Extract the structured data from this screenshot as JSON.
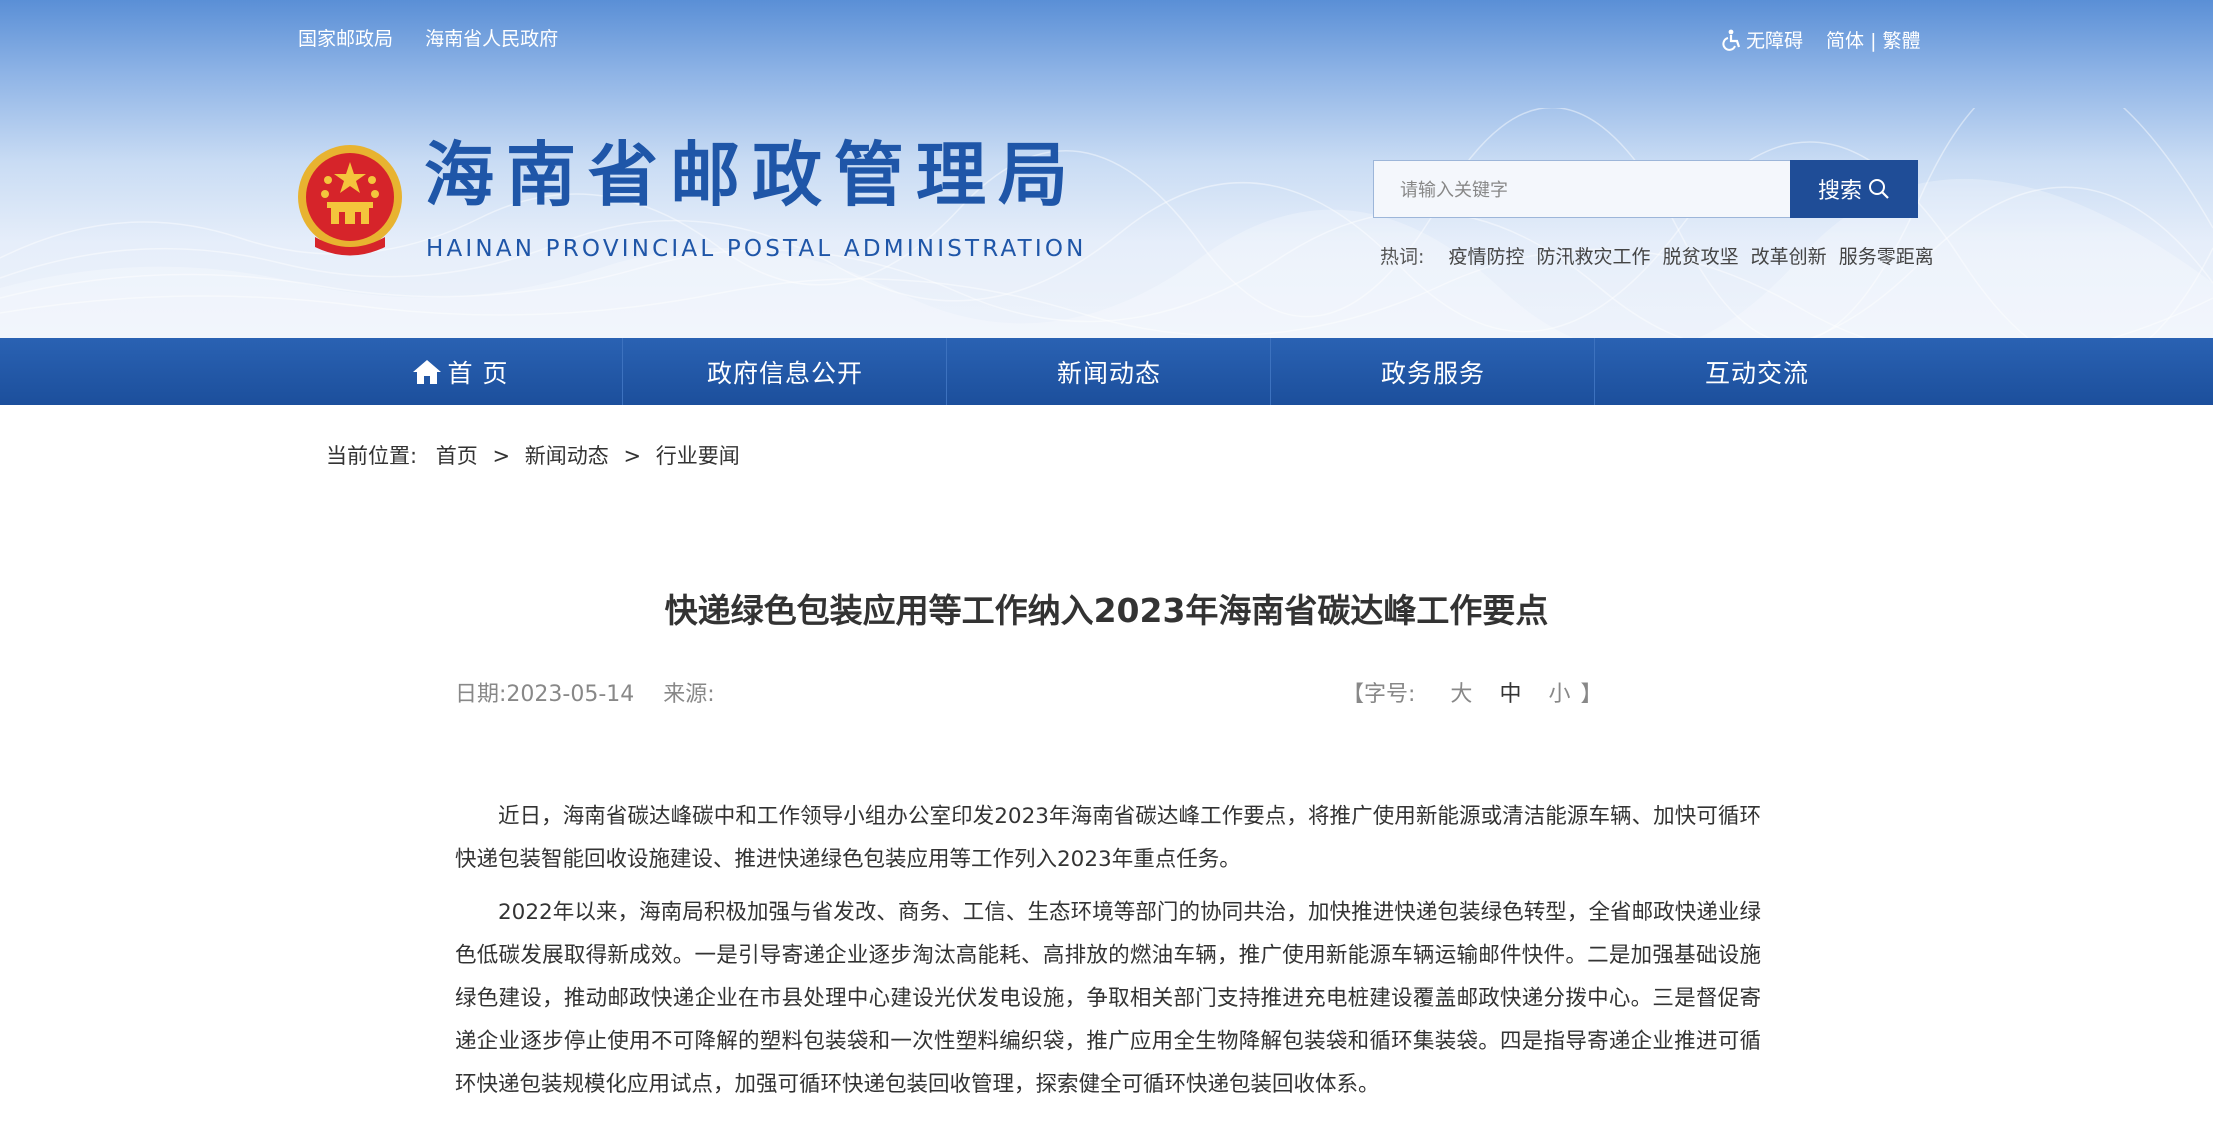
{
  "top_links": [
    "国家邮政局",
    "海南省人民政府"
  ],
  "accessibility_label": "无障碍",
  "lang": {
    "simplified": "简体",
    "divider": "|",
    "traditional": "繁體"
  },
  "site": {
    "title_cn": "海南省邮政管理局",
    "title_en": "HAINAN PROVINCIAL POSTAL ADMINISTRATION"
  },
  "search": {
    "placeholder": "请输入关键字",
    "button": "搜索"
  },
  "hot_words": {
    "label": "热词:",
    "items": [
      "疫情防控",
      "防汛救灾工作",
      "脱贫攻坚",
      "改革创新",
      "服务零距离"
    ]
  },
  "nav": [
    "首 页",
    "政府信息公开",
    "新闻动态",
    "政务服务",
    "互动交流"
  ],
  "breadcrumb": {
    "label": "当前位置:",
    "items": [
      "首页",
      "新闻动态",
      "行业要闻"
    ],
    "separator": ">"
  },
  "article": {
    "title": "快递绿色包装应用等工作纳入2023年海南省碳达峰工作要点",
    "date_label": "日期:",
    "date": "2023-05-14",
    "source_label": "来源:",
    "font_size": {
      "open": "【字号:",
      "large": "大",
      "medium": "中",
      "small": "小",
      "close": "】"
    },
    "paragraphs": [
      "近日，海南省碳达峰碳中和工作领导小组办公室印发2023年海南省碳达峰工作要点，将推广使用新能源或清洁能源车辆、加快可循环快递包装智能回收设施建设、推进快递绿色包装应用等工作列入2023年重点任务。",
      "2022年以来，海南局积极加强与省发改、商务、工信、生态环境等部门的协同共治，加快推进快递包装绿色转型，全省邮政快递业绿色低碳发展取得新成效。一是引导寄递企业逐步淘汰高能耗、高排放的燃油车辆，推广使用新能源车辆运输邮件快件。二是加强基础设施绿色建设，推动邮政快递企业在市县处理中心建设光伏发电设施，争取相关部门支持推进充电桩建设覆盖邮政快递分拨中心。三是督促寄递企业逐步停止使用不可降解的塑料包装袋和一次性塑料编织袋，推广应用全生物降解包装袋和循环集装袋。四是指导寄递企业推进可循环快递包装规模化应用试点，加强可循环快递包装回收管理，探索健全可循环快递包装回收体系。"
    ]
  },
  "colors": {
    "brand_blue": "#1f56a8",
    "nav_blue": "#1c4f9c",
    "text": "#333333"
  },
  "icons": [
    "national-emblem-icon",
    "accessibility-icon",
    "search-icon",
    "home-icon"
  ]
}
